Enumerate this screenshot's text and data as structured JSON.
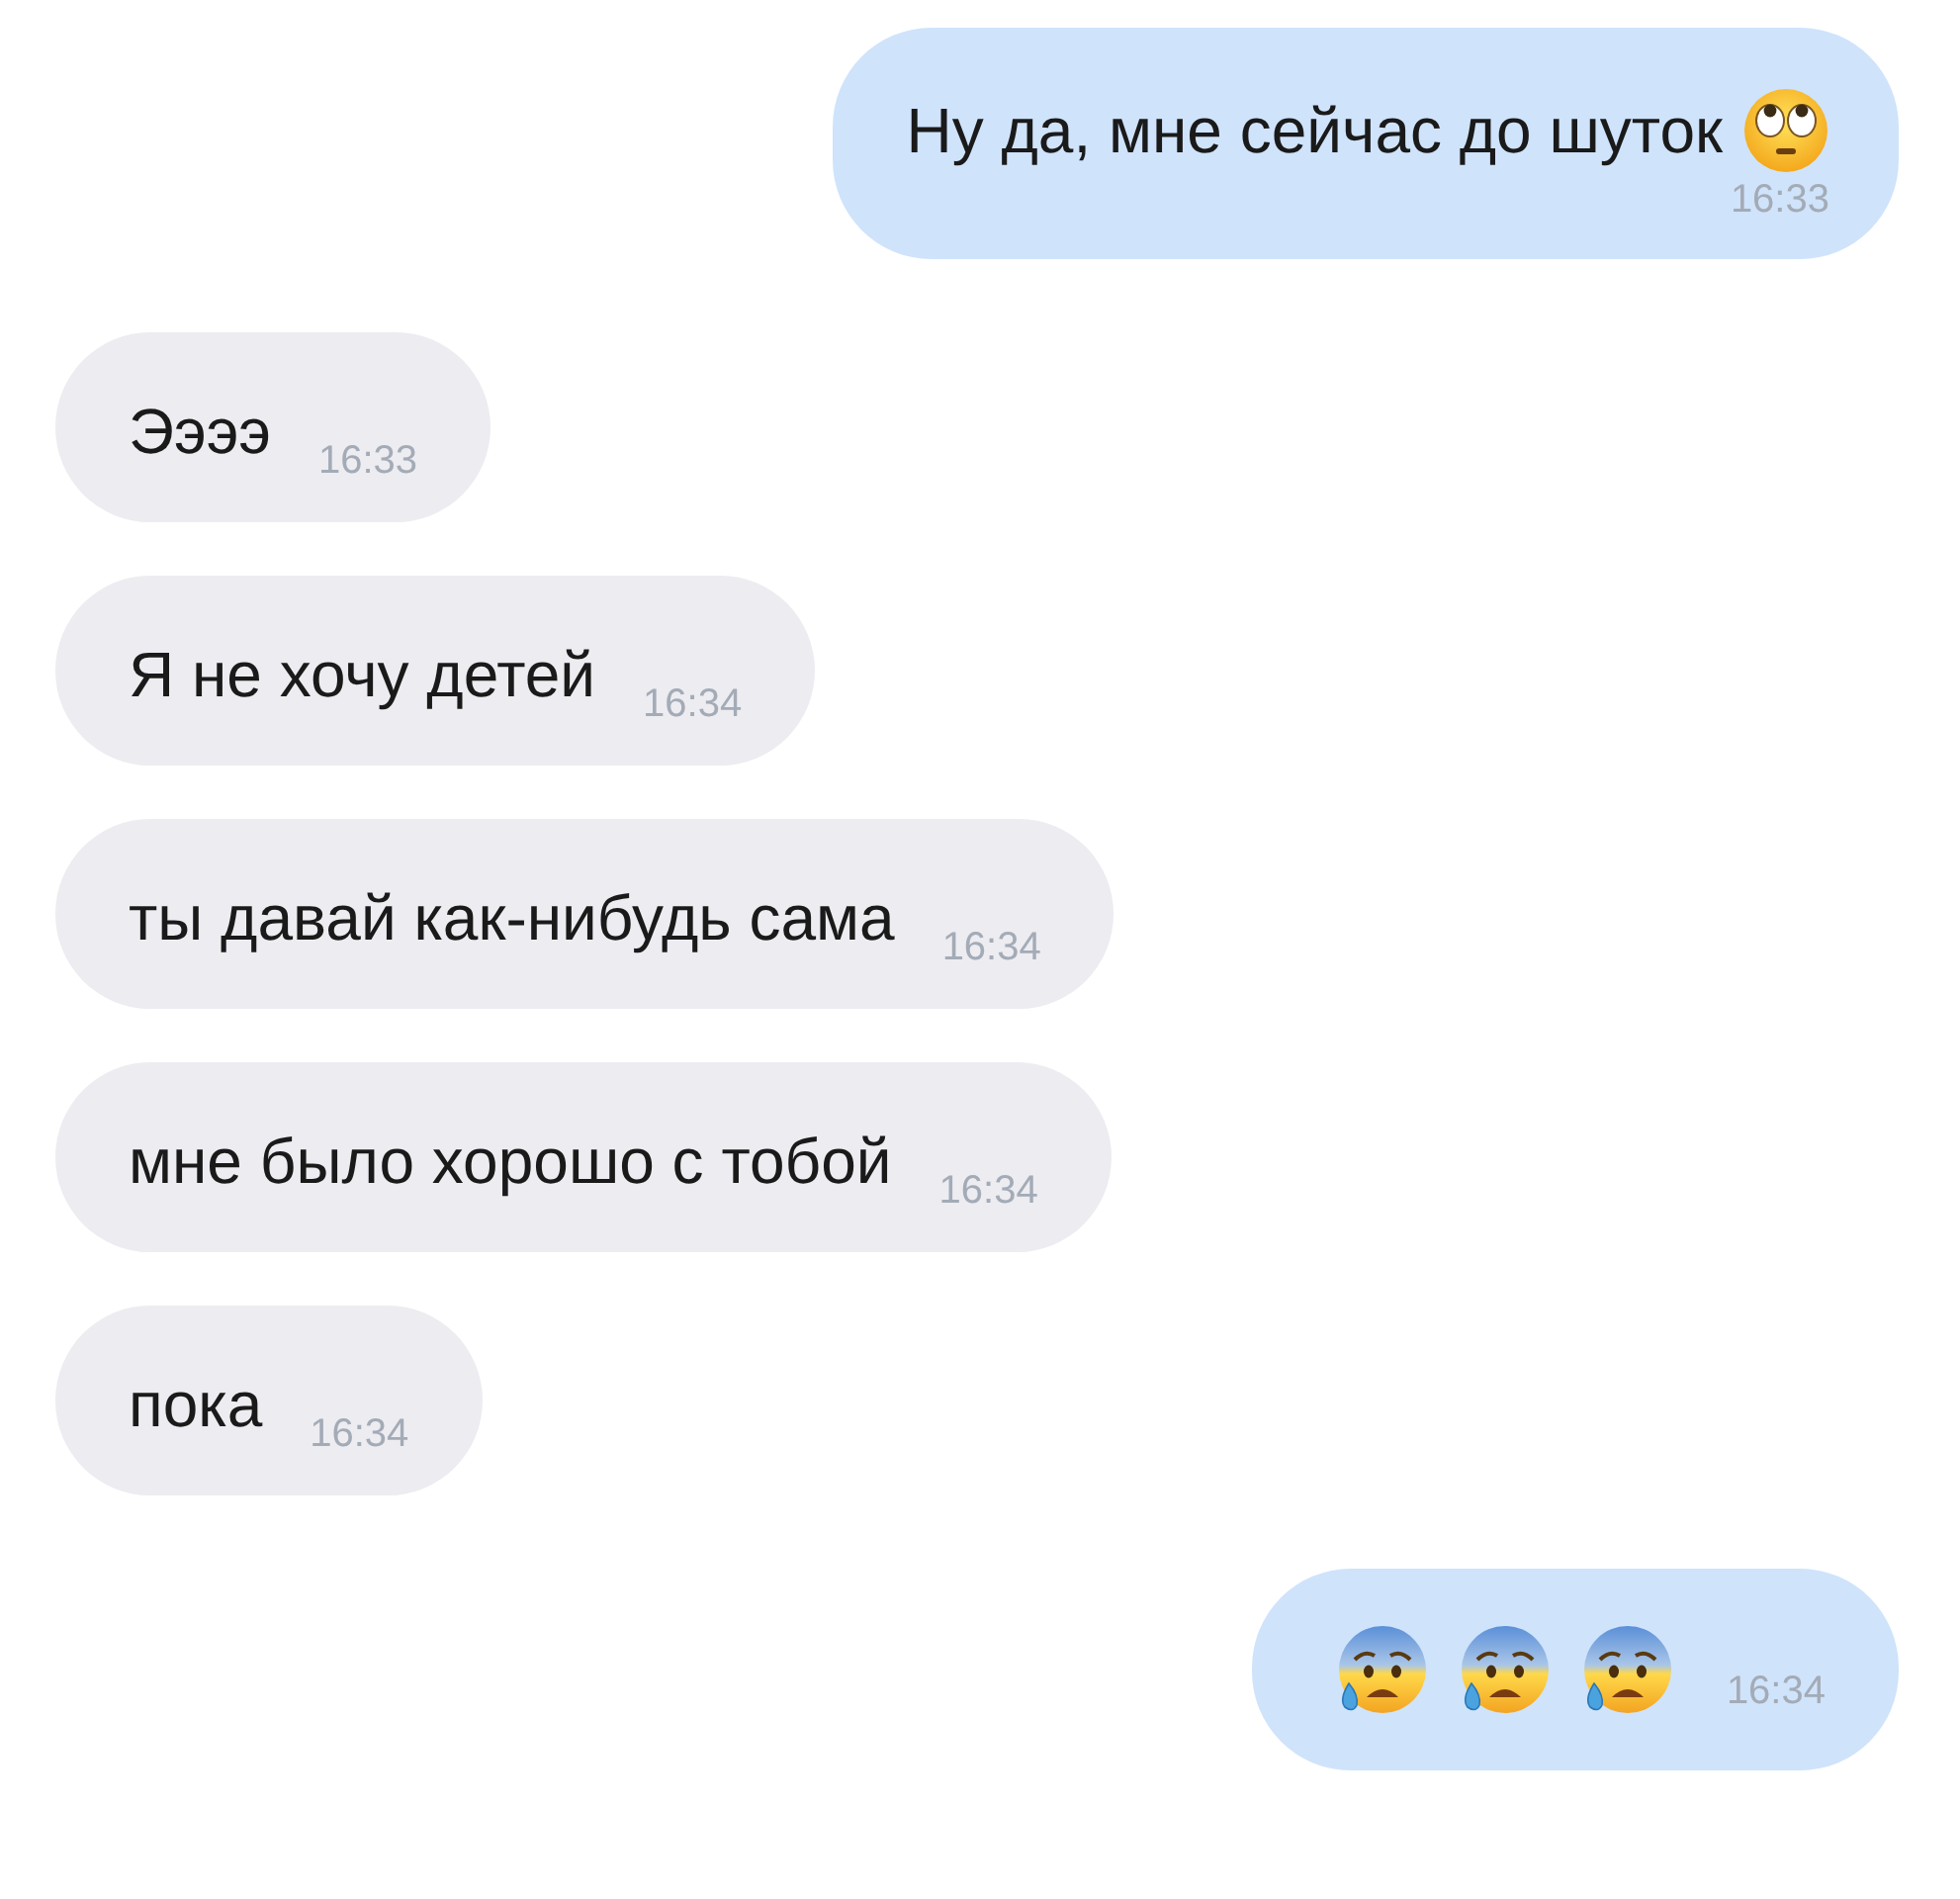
{
  "messages": [
    {
      "kind": "outgoing",
      "text": "Ну да, мне сейчас до шуток",
      "emoji": [
        {
          "kind": "rolling-eyes"
        }
      ],
      "time": "16:33"
    },
    {
      "kind": "incoming",
      "text": "Ээээ",
      "time": "16:33"
    },
    {
      "kind": "incoming",
      "text": "Я не хочу детей",
      "time": "16:34"
    },
    {
      "kind": "incoming",
      "text": "ты давай как-нибудь сама",
      "time": "16:34"
    },
    {
      "kind": "incoming",
      "text": "мне было хорошо с тобой",
      "time": "16:34"
    },
    {
      "kind": "incoming",
      "text": "пока",
      "time": "16:34"
    },
    {
      "kind": "outgoing",
      "emoji": [
        {
          "kind": "anxious-sweat"
        },
        {
          "kind": "anxious-sweat"
        },
        {
          "kind": "anxious-sweat"
        }
      ],
      "time": "16:34"
    }
  ]
}
